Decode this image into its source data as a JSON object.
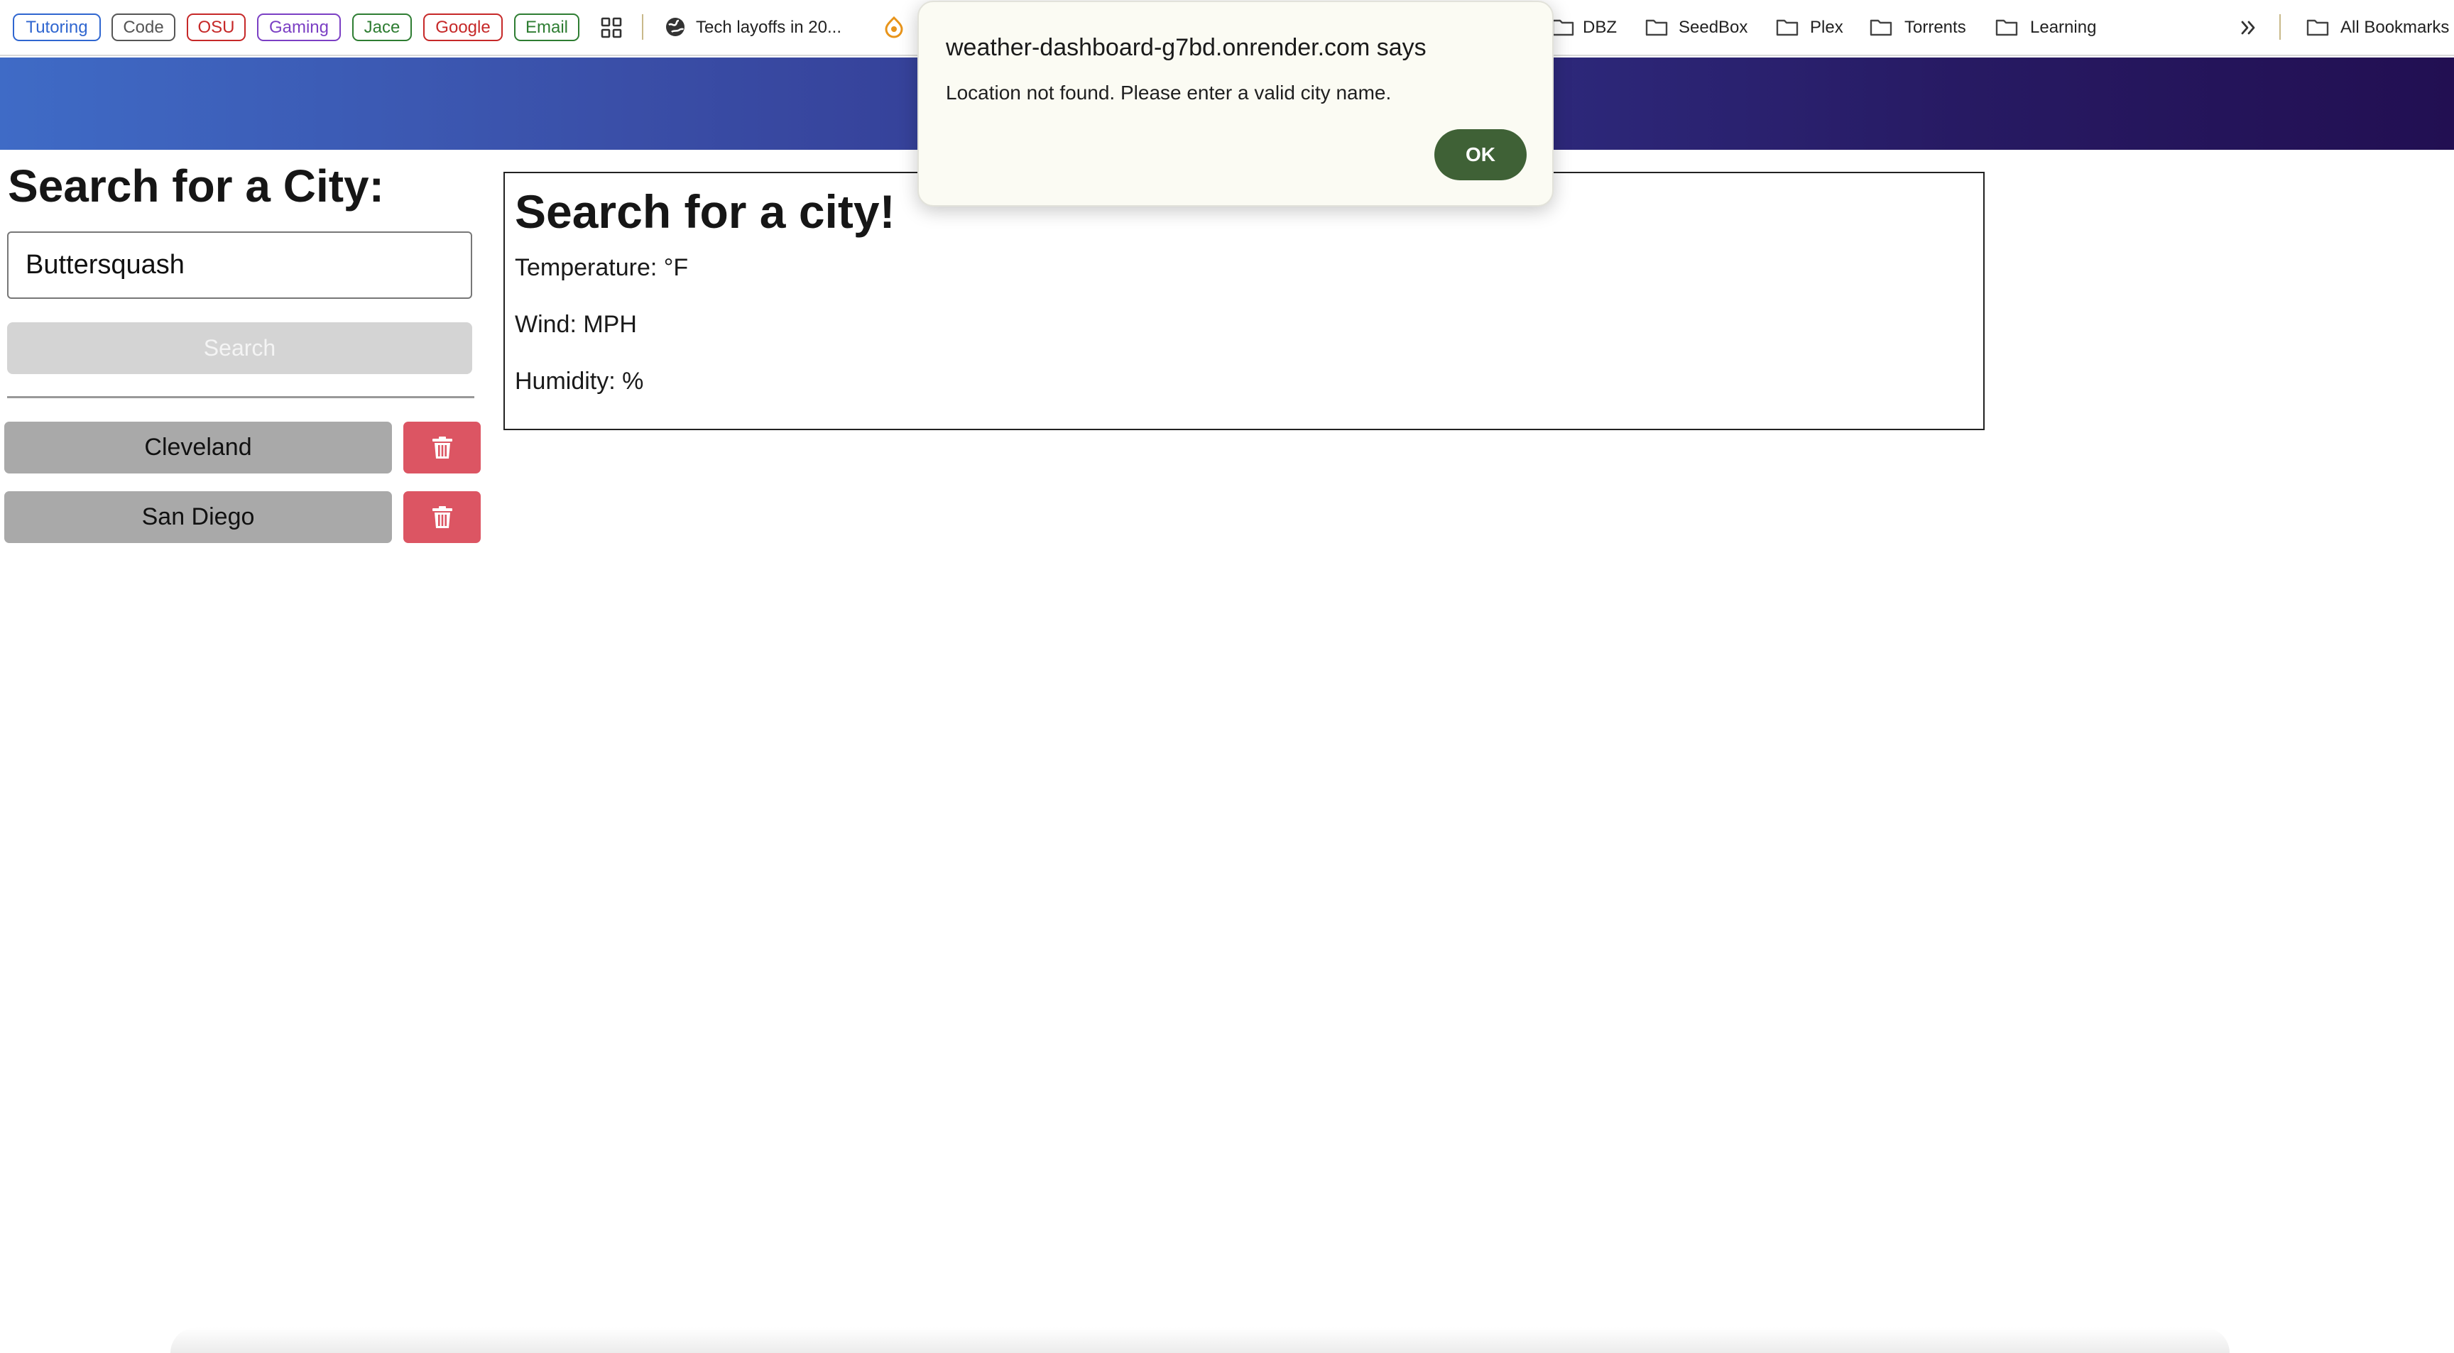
{
  "bookmarks_bar": {
    "tags": [
      {
        "label": "Tutoring",
        "color": "#2f66d0"
      },
      {
        "label": "Code",
        "color": "#555555"
      },
      {
        "label": "OSU",
        "color": "#c62828"
      },
      {
        "label": "Gaming",
        "color": "#7b3fc4"
      },
      {
        "label": "Jace",
        "color": "#2e7d32"
      },
      {
        "label": "Google",
        "color": "#c62828"
      },
      {
        "label": "Email",
        "color": "#2e7d32"
      }
    ],
    "apps_icon": "grid-icon",
    "links": [
      {
        "label": "Tech layoffs in 20...",
        "icon": "globe-icon"
      },
      {
        "label": "",
        "icon": "extension-icon"
      }
    ],
    "folders": [
      "DBZ",
      "SeedBox",
      "Plex",
      "Torrents",
      "Learning"
    ],
    "overflow_icon": "double-chevron-right-icon",
    "all_bookmarks": "All Bookmarks"
  },
  "header": {
    "gradient_start": "#3f6bc6",
    "gradient_end": "#220f52"
  },
  "sidebar": {
    "heading": "Search for a City:",
    "input_value": "Buttersquash",
    "search_label": "Search",
    "history": [
      "Cleveland",
      "San Diego"
    ],
    "delete_icon": "trash-icon",
    "delete_color": "#dc5563"
  },
  "weather": {
    "title": "Search for a city!",
    "temperature": "Temperature: °F",
    "wind": "Wind: MPH",
    "humidity": "Humidity: %"
  },
  "alert": {
    "title": "weather-dashboard-g7bd.onrender.com says",
    "message": "Location not found. Please enter a valid city name.",
    "ok_label": "OK",
    "ok_color": "#3f6136"
  }
}
